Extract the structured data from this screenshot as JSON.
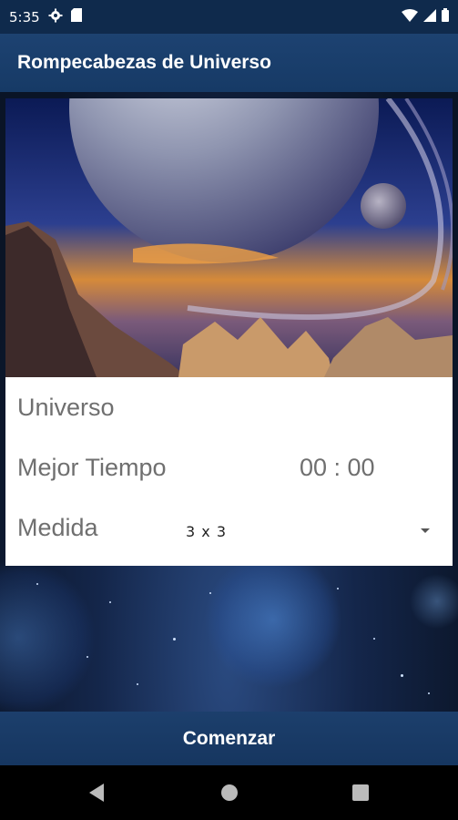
{
  "status_bar": {
    "time": "5:35",
    "icons": [
      "settings-gear-icon",
      "sd-card-icon",
      "wifi-icon",
      "signal-icon",
      "battery-icon"
    ]
  },
  "app_bar": {
    "title": "Rompecabezas de Universo"
  },
  "puzzle": {
    "name": "Universo",
    "best_time_label": "Mejor Tiempo",
    "best_time_value": "00 : 00",
    "size_label": "Medida",
    "size_selected": "3 x 3"
  },
  "start_button": {
    "label": "Comenzar"
  },
  "nav_bar": {
    "icons": [
      "back-icon",
      "home-icon",
      "recents-icon"
    ]
  },
  "colors": {
    "app_bar": "#163a66",
    "status_bar": "#0f2a4c",
    "card": "#ffffff",
    "label_text": "#6f6f6f"
  }
}
